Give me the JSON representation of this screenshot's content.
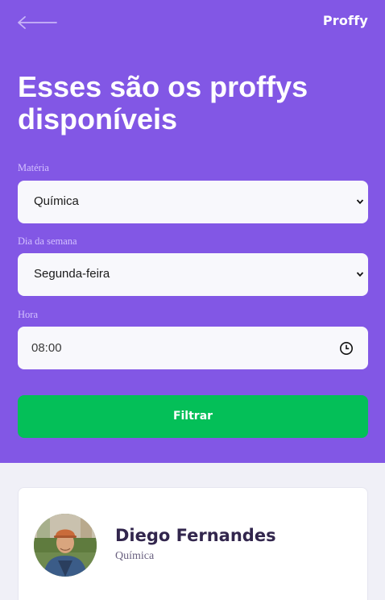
{
  "header": {
    "logo": "Proffy",
    "title": "Esses são os proffys disponíveis"
  },
  "filters": {
    "subject": {
      "label": "Matéria",
      "value": "Química"
    },
    "weekday": {
      "label": "Dia da semana",
      "value": "Segunda-feira"
    },
    "time": {
      "label": "Hora",
      "value": "08:00"
    },
    "submit_label": "Filtrar"
  },
  "results": [
    {
      "name": "Diego Fernandes",
      "subject": "Química"
    }
  ],
  "icons": {
    "back": "arrow-left-icon",
    "select": "chevron-down-icon",
    "time": "clock-icon"
  },
  "colors": {
    "primary": "#8257E5",
    "button": "#04BF58",
    "background": "#F0F0F7",
    "card": "#FFFFFF"
  }
}
